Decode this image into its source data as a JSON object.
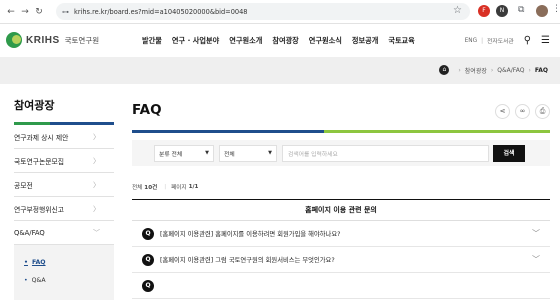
{
  "browser": {
    "url": "krihs.re.kr/board.es?mid=a10405020000&bid=0048",
    "ext1": "F",
    "ext2": "N"
  },
  "header": {
    "logo_text": "KRIHS",
    "logo_sub": "국토연구원",
    "menu": [
      "발간물",
      "연구 · 사업분야",
      "연구원소개",
      "참여광장",
      "연구원소식",
      "정보공개",
      "국토교육"
    ],
    "lang": "ENG",
    "elib": "전자도서관"
  },
  "breadcrumb": {
    "items": [
      "참여광장",
      "Q&A/FAQ"
    ],
    "current": "FAQ"
  },
  "sidebar": {
    "title": "참여광장",
    "items": [
      {
        "label": "연구과제 상시 제안"
      },
      {
        "label": "국토연구논문모집"
      },
      {
        "label": "공모전"
      },
      {
        "label": "연구부정행위신고"
      },
      {
        "label": "Q&A/FAQ"
      }
    ],
    "sub_items": [
      {
        "label": "FAQ",
        "active": true
      },
      {
        "label": "Q&A",
        "active": false
      }
    ]
  },
  "main": {
    "title": "FAQ",
    "search": {
      "category": "분류 전체",
      "scope": "전체",
      "placeholder": "검색어를 입력하세요",
      "button": "검색"
    },
    "meta": {
      "total_label": "전체",
      "total_value": "10건",
      "page_label": "페이지",
      "page_value": "1/1"
    },
    "section_title": "홈페이지 이용 관련 문의",
    "faqs": [
      {
        "q": "[홈페이지 이용관련] 홈페이지를 이용하려면 회원가입을 해야하나요?"
      },
      {
        "q": "[홈페이지 이용관련] 그럼 국토연구원의 회원서비스는 무엇인가요?"
      },
      {
        "q": ""
      }
    ]
  }
}
